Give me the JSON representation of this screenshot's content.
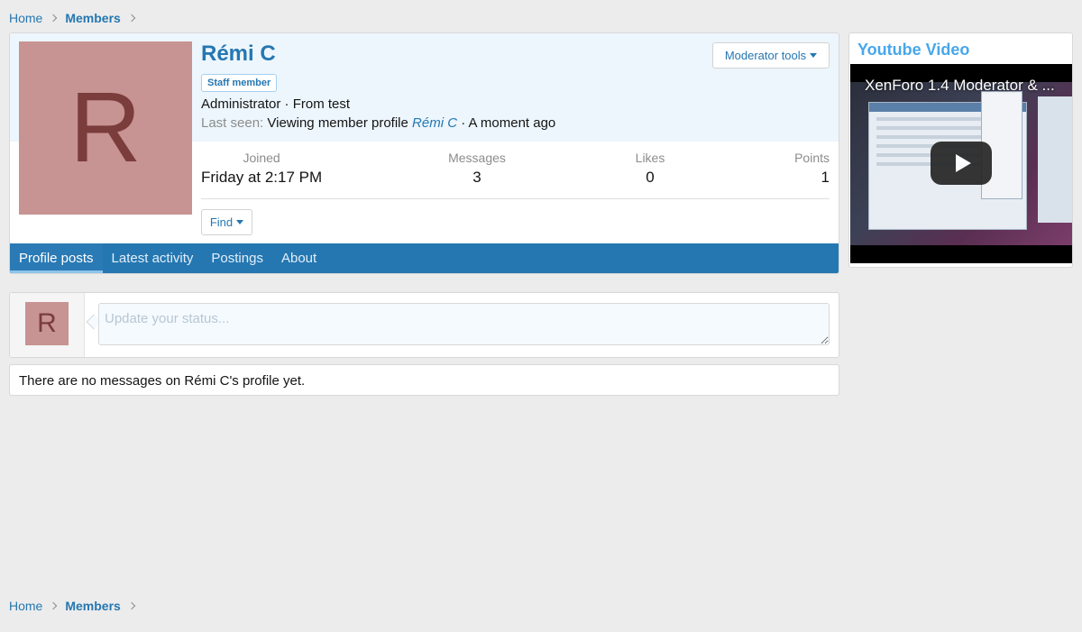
{
  "breadcrumb": {
    "items": [
      {
        "label": "Home"
      },
      {
        "label": "Members"
      }
    ]
  },
  "profile": {
    "avatar_letter": "R",
    "username": "Rémi C",
    "badge": "Staff member",
    "title_line": "Administrator · From test",
    "last_seen_label": "Last seen:",
    "last_seen_action": "Viewing member profile",
    "last_seen_link": "Rémi C",
    "last_seen_time": "· A moment ago",
    "moderator_tools_label": "Moderator tools",
    "stats": {
      "joined_label": "Joined",
      "joined_value": "Friday at 2:17 PM",
      "messages_label": "Messages",
      "messages_value": "3",
      "likes_label": "Likes",
      "likes_value": "0",
      "points_label": "Points",
      "points_value": "1"
    },
    "find_label": "Find",
    "tabs": [
      {
        "label": "Profile posts",
        "active": true
      },
      {
        "label": "Latest activity",
        "active": false
      },
      {
        "label": "Postings",
        "active": false
      },
      {
        "label": "About",
        "active": false
      }
    ]
  },
  "status": {
    "avatar_letter": "R",
    "placeholder": "Update your status..."
  },
  "no_messages_text": "There are no messages on Rémi C's profile yet.",
  "sidebar": {
    "title": "Youtube Video",
    "video_title": "XenForo 1.4 Moderator & ..."
  },
  "colors": {
    "accent": "#2577b1",
    "avatar_bg": "#c79393",
    "avatar_letter": "#7b3c3c",
    "header_bg": "#edf6fd",
    "page_bg": "#ececec"
  }
}
